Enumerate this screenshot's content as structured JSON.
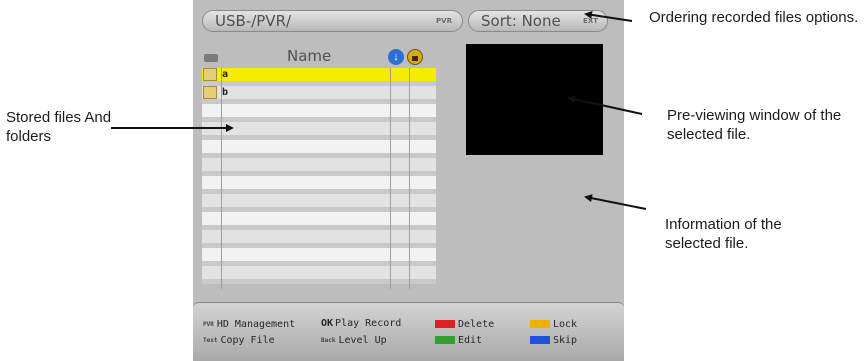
{
  "header": {
    "path_label": "USB-/PVR/",
    "path_badge": "PVR",
    "sort_label": "Sort: None",
    "sort_badge": "EXT"
  },
  "list": {
    "column_name_header": "Name",
    "items": [
      {
        "label": "a",
        "type": "folder",
        "selected": true
      },
      {
        "label": "b",
        "type": "folder",
        "selected": false
      }
    ]
  },
  "footer": {
    "row1": [
      {
        "key": "PVR",
        "label": "HD Management"
      },
      {
        "key": "OK",
        "label": "Play Record"
      },
      {
        "color": "#e02020",
        "label": "Delete"
      },
      {
        "color": "#f0b000",
        "label": "Lock"
      }
    ],
    "row2": [
      {
        "key": "Text",
        "label": "Copy File"
      },
      {
        "key": "Back",
        "label": "Level Up"
      },
      {
        "color": "#30a030",
        "label": "Edit"
      },
      {
        "color": "#2050e0",
        "label": "Skip"
      }
    ]
  },
  "annotations": {
    "ordering": "Ordering recorded files options.",
    "stored": "Stored files And folders",
    "preview": "Pre-viewing window of the selected file.",
    "info": "Information of the selected file."
  },
  "colors": {
    "selection": "#f5ec00",
    "panel": "#bdbdbd",
    "preview": "#000000"
  },
  "icons": [
    "storage-icon",
    "download-icon",
    "lock-icon",
    "folder-icon"
  ]
}
